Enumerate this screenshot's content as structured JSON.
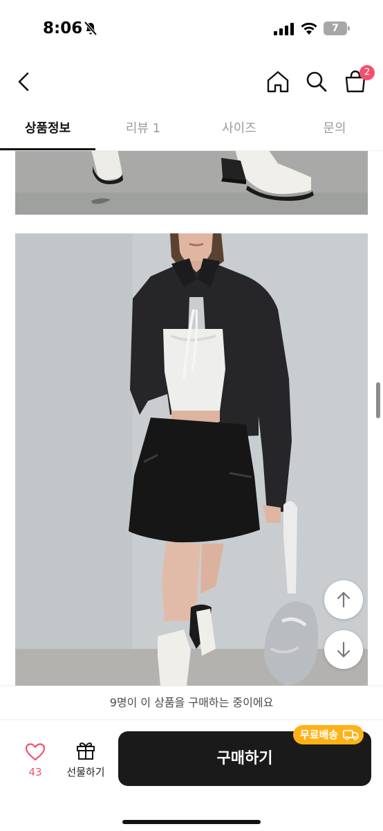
{
  "status_bar": {
    "time": "8:06",
    "battery_level": "7"
  },
  "header": {
    "cart_count": "2"
  },
  "tabs": [
    {
      "label": "상품정보",
      "active": true
    },
    {
      "label": "리뷰 1",
      "active": false
    },
    {
      "label": "사이즈",
      "active": false
    },
    {
      "label": "문의",
      "active": false
    }
  ],
  "notice": "9명이 이 상품을 구매하는 중이에요",
  "bottom_bar": {
    "like_count": "43",
    "gift_label": "선물하기",
    "buy_label": "구매하기",
    "badge_label": "무료배송"
  },
  "icons": [
    "back-icon",
    "home-icon",
    "search-icon",
    "cart-icon",
    "heart-icon",
    "gift-icon",
    "truck-icon",
    "arrow-up-icon",
    "arrow-down-icon"
  ],
  "colors": {
    "accent_pink": "#f4506d",
    "badge_orange": "#ffb217",
    "buy_button": "#1a1a1a"
  }
}
